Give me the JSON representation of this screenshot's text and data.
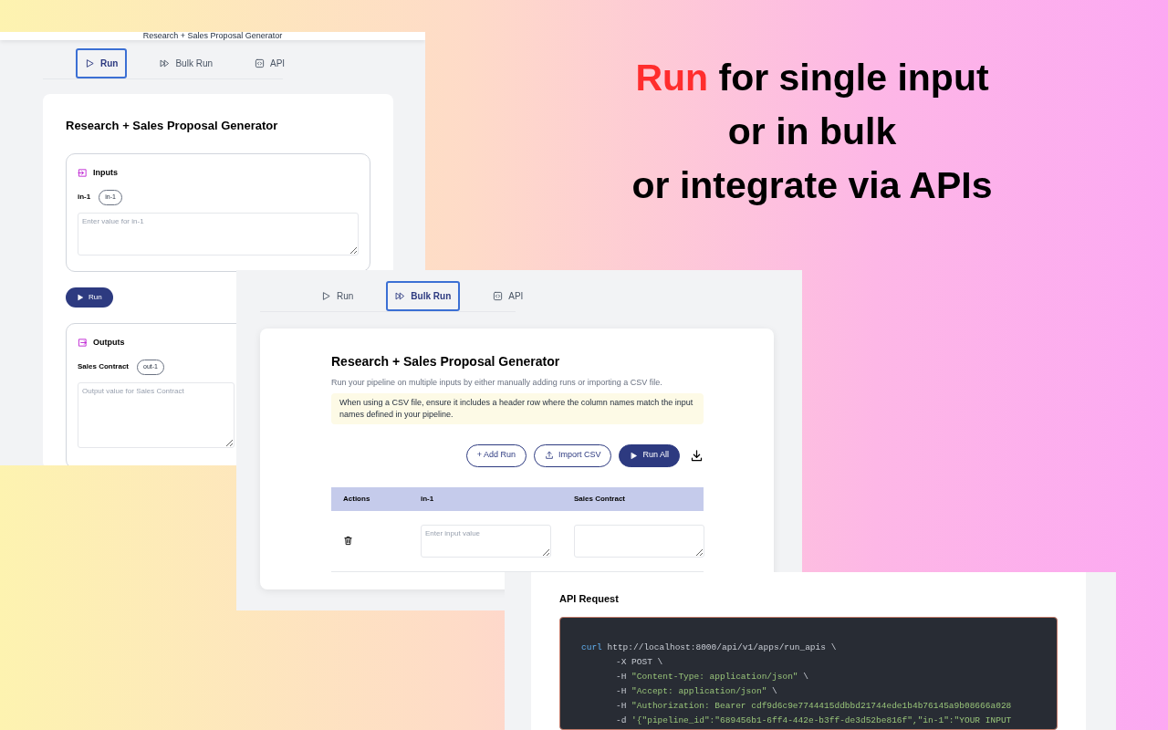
{
  "headline": [
    {
      "segments": [
        {
          "text": "Run",
          "accent": true
        },
        {
          "text": " for single input",
          "accent": false
        }
      ]
    },
    {
      "segments": [
        {
          "text": "or in bulk",
          "accent": false
        }
      ]
    },
    {
      "segments": [
        {
          "text": "or integrate via APIs",
          "accent": false
        }
      ]
    }
  ],
  "run_view": {
    "header_title": "Research + Sales Proposal Generator",
    "tabs": [
      {
        "label": "Run",
        "kind": "run",
        "selected": true
      },
      {
        "label": "Bulk Run",
        "kind": "bulk",
        "selected": false
      },
      {
        "label": "API",
        "kind": "api",
        "selected": false
      }
    ],
    "title": "Research + Sales Proposal Generator",
    "inputs": {
      "heading": "Inputs",
      "field": {
        "label": "in-1",
        "tag": "in-1",
        "placeholder": "Enter value for in-1"
      }
    },
    "run_button": "Run",
    "outputs": {
      "heading": "Outputs",
      "field": {
        "label": "Sales Contract",
        "tag": "out-1",
        "placeholder": "Output value for Sales Contract"
      }
    }
  },
  "bulk_view": {
    "tabs": [
      {
        "label": "Run",
        "kind": "run",
        "selected": false
      },
      {
        "label": "Bulk Run",
        "kind": "bulk",
        "selected": true
      },
      {
        "label": "API",
        "kind": "api",
        "selected": false
      }
    ],
    "title": "Research + Sales Proposal Generator",
    "description": "Run your pipeline on multiple inputs by either manually adding runs or importing a CSV file.",
    "notice": "When using a CSV file, ensure it includes a header row where the column names match the input names defined in your pipeline.",
    "buttons": [
      {
        "label": "+ Add Run",
        "kind": "outline"
      },
      {
        "label": "Import CSV",
        "kind": "import"
      },
      {
        "label": "Run All",
        "kind": "primary"
      }
    ],
    "table": {
      "columns": [
        "Actions",
        "in-1",
        "Sales Contract"
      ],
      "rows": [
        {
          "input_placeholder": "Enter input value"
        }
      ]
    }
  },
  "api_view": {
    "heading": "API Request",
    "code_lines": [
      {
        "indent": false,
        "tokens": [
          {
            "kind": "keyword",
            "text": "curl"
          },
          {
            "kind": "plain",
            "text": " http://localhost:8000/api/v1/apps/run_apis \\"
          }
        ]
      },
      {
        "indent": true,
        "tokens": [
          {
            "kind": "plain",
            "text": "-X POST \\"
          }
        ]
      },
      {
        "indent": true,
        "tokens": [
          {
            "kind": "plain",
            "text": "-H "
          },
          {
            "kind": "string",
            "text": "\"Content-Type: application/json\""
          },
          {
            "kind": "plain",
            "text": " \\"
          }
        ]
      },
      {
        "indent": true,
        "tokens": [
          {
            "kind": "plain",
            "text": "-H "
          },
          {
            "kind": "string",
            "text": "\"Accept: application/json\""
          },
          {
            "kind": "plain",
            "text": " \\"
          }
        ]
      },
      {
        "indent": true,
        "tokens": [
          {
            "kind": "plain",
            "text": "-H "
          },
          {
            "kind": "string",
            "text": "\"Authorization: Bearer cdf9d6c9e7744415ddbbd21744ede1b4b76145a9b08666a028"
          }
        ]
      },
      {
        "indent": true,
        "tokens": [
          {
            "kind": "plain",
            "text": "-d "
          },
          {
            "kind": "string",
            "text": "'{\"pipeline_id\":\"689456b1-6ff4-442e-b3ff-de3d52be816f\",\"in-1\":\"YOUR INPUT"
          }
        ]
      }
    ]
  }
}
